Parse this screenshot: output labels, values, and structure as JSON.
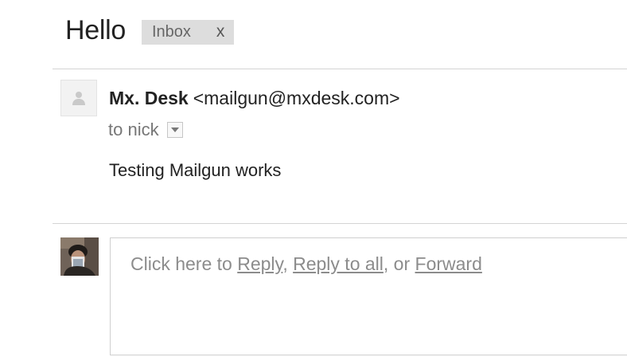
{
  "thread": {
    "subject": "Hello",
    "label": {
      "name": "Inbox",
      "remove": "x"
    }
  },
  "message": {
    "sender_name": "Mx. Desk",
    "sender_email": "<mailgun@mxdesk.com>",
    "to": "to nick",
    "body": "Testing Mailgun works",
    "avatar_icon": "person-silhouette-icon"
  },
  "reply": {
    "prefix": "Click here to ",
    "reply_link": "Reply",
    "sep1": ", ",
    "reply_all_link": "Reply to all",
    "sep2": ", or ",
    "forward_link": "Forward"
  },
  "colors": {
    "text": "#222222",
    "muted": "#777777",
    "chip_bg": "#dddddd",
    "divider": "#d4d4d4",
    "reply_text": "#8c8c8c"
  }
}
